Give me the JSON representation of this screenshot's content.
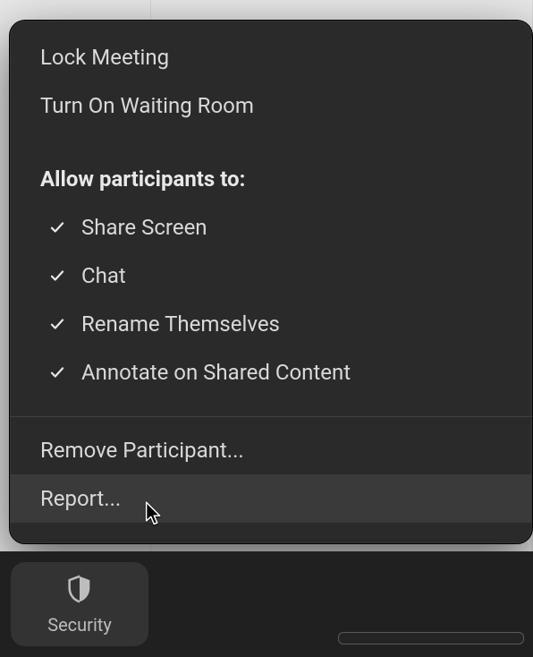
{
  "menu": {
    "items_top": [
      {
        "label": "Lock Meeting"
      },
      {
        "label": "Turn On Waiting Room"
      }
    ],
    "allow_heading": "Allow participants to:",
    "allow_items": [
      {
        "label": "Share Screen",
        "checked": true
      },
      {
        "label": "Chat",
        "checked": true
      },
      {
        "label": "Rename Themselves",
        "checked": true
      },
      {
        "label": "Annotate on Shared Content",
        "checked": true
      }
    ],
    "items_bottom": [
      {
        "label": "Remove Participant...",
        "hovered": false
      },
      {
        "label": "Report...",
        "hovered": true
      }
    ]
  },
  "toolbar": {
    "security_label": "Security"
  }
}
